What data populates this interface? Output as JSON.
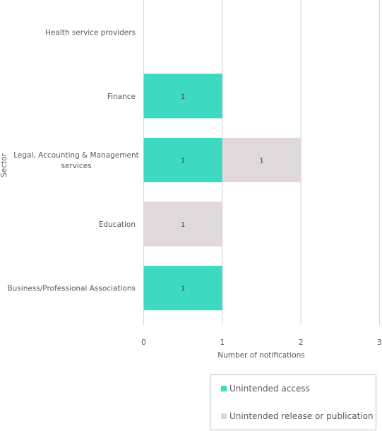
{
  "chart_data": {
    "type": "bar",
    "orientation": "horizontal",
    "stacked": true,
    "title": "",
    "xlabel": "Number of notifications",
    "ylabel": "Sector",
    "xlim": [
      0,
      3
    ],
    "xticks": [
      "0",
      "1",
      "2",
      "3"
    ],
    "grid": true,
    "legend_position": "bottom-right",
    "categories": [
      "Health service providers",
      "Finance",
      "Legal, Accounting & Management services",
      "Education",
      "Business/Professional Associations"
    ],
    "category_lines": [
      [
        "Health service providers"
      ],
      [
        "Finance"
      ],
      [
        "Legal, Accounting & Management",
        "services"
      ],
      [
        "Education"
      ],
      [
        "Business/Professional Associations"
      ]
    ],
    "series": [
      {
        "name": "Unintended access",
        "color": "#3DD9C1",
        "values": [
          0,
          1,
          1,
          0,
          1
        ]
      },
      {
        "name": "Unintended release or publication",
        "color": "#E0D9DB",
        "values": [
          0,
          0,
          1,
          1,
          0
        ]
      }
    ]
  }
}
